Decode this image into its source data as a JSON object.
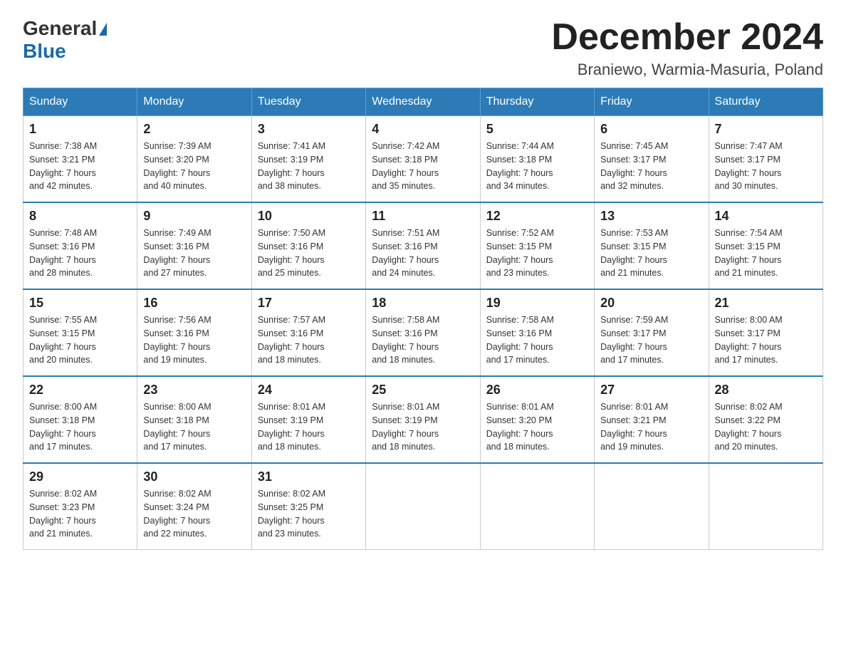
{
  "header": {
    "logo_general": "General",
    "logo_blue": "Blue",
    "month_title": "December 2024",
    "location": "Braniewo, Warmia-Masuria, Poland"
  },
  "weekdays": [
    "Sunday",
    "Monday",
    "Tuesday",
    "Wednesday",
    "Thursday",
    "Friday",
    "Saturday"
  ],
  "weeks": [
    [
      {
        "day": "1",
        "sunrise": "7:38 AM",
        "sunset": "3:21 PM",
        "daylight": "7 hours and 42 minutes."
      },
      {
        "day": "2",
        "sunrise": "7:39 AM",
        "sunset": "3:20 PM",
        "daylight": "7 hours and 40 minutes."
      },
      {
        "day": "3",
        "sunrise": "7:41 AM",
        "sunset": "3:19 PM",
        "daylight": "7 hours and 38 minutes."
      },
      {
        "day": "4",
        "sunrise": "7:42 AM",
        "sunset": "3:18 PM",
        "daylight": "7 hours and 35 minutes."
      },
      {
        "day": "5",
        "sunrise": "7:44 AM",
        "sunset": "3:18 PM",
        "daylight": "7 hours and 34 minutes."
      },
      {
        "day": "6",
        "sunrise": "7:45 AM",
        "sunset": "3:17 PM",
        "daylight": "7 hours and 32 minutes."
      },
      {
        "day": "7",
        "sunrise": "7:47 AM",
        "sunset": "3:17 PM",
        "daylight": "7 hours and 30 minutes."
      }
    ],
    [
      {
        "day": "8",
        "sunrise": "7:48 AM",
        "sunset": "3:16 PM",
        "daylight": "7 hours and 28 minutes."
      },
      {
        "day": "9",
        "sunrise": "7:49 AM",
        "sunset": "3:16 PM",
        "daylight": "7 hours and 27 minutes."
      },
      {
        "day": "10",
        "sunrise": "7:50 AM",
        "sunset": "3:16 PM",
        "daylight": "7 hours and 25 minutes."
      },
      {
        "day": "11",
        "sunrise": "7:51 AM",
        "sunset": "3:16 PM",
        "daylight": "7 hours and 24 minutes."
      },
      {
        "day": "12",
        "sunrise": "7:52 AM",
        "sunset": "3:15 PM",
        "daylight": "7 hours and 23 minutes."
      },
      {
        "day": "13",
        "sunrise": "7:53 AM",
        "sunset": "3:15 PM",
        "daylight": "7 hours and 21 minutes."
      },
      {
        "day": "14",
        "sunrise": "7:54 AM",
        "sunset": "3:15 PM",
        "daylight": "7 hours and 21 minutes."
      }
    ],
    [
      {
        "day": "15",
        "sunrise": "7:55 AM",
        "sunset": "3:15 PM",
        "daylight": "7 hours and 20 minutes."
      },
      {
        "day": "16",
        "sunrise": "7:56 AM",
        "sunset": "3:16 PM",
        "daylight": "7 hours and 19 minutes."
      },
      {
        "day": "17",
        "sunrise": "7:57 AM",
        "sunset": "3:16 PM",
        "daylight": "7 hours and 18 minutes."
      },
      {
        "day": "18",
        "sunrise": "7:58 AM",
        "sunset": "3:16 PM",
        "daylight": "7 hours and 18 minutes."
      },
      {
        "day": "19",
        "sunrise": "7:58 AM",
        "sunset": "3:16 PM",
        "daylight": "7 hours and 17 minutes."
      },
      {
        "day": "20",
        "sunrise": "7:59 AM",
        "sunset": "3:17 PM",
        "daylight": "7 hours and 17 minutes."
      },
      {
        "day": "21",
        "sunrise": "8:00 AM",
        "sunset": "3:17 PM",
        "daylight": "7 hours and 17 minutes."
      }
    ],
    [
      {
        "day": "22",
        "sunrise": "8:00 AM",
        "sunset": "3:18 PM",
        "daylight": "7 hours and 17 minutes."
      },
      {
        "day": "23",
        "sunrise": "8:00 AM",
        "sunset": "3:18 PM",
        "daylight": "7 hours and 17 minutes."
      },
      {
        "day": "24",
        "sunrise": "8:01 AM",
        "sunset": "3:19 PM",
        "daylight": "7 hours and 18 minutes."
      },
      {
        "day": "25",
        "sunrise": "8:01 AM",
        "sunset": "3:19 PM",
        "daylight": "7 hours and 18 minutes."
      },
      {
        "day": "26",
        "sunrise": "8:01 AM",
        "sunset": "3:20 PM",
        "daylight": "7 hours and 18 minutes."
      },
      {
        "day": "27",
        "sunrise": "8:01 AM",
        "sunset": "3:21 PM",
        "daylight": "7 hours and 19 minutes."
      },
      {
        "day": "28",
        "sunrise": "8:02 AM",
        "sunset": "3:22 PM",
        "daylight": "7 hours and 20 minutes."
      }
    ],
    [
      {
        "day": "29",
        "sunrise": "8:02 AM",
        "sunset": "3:23 PM",
        "daylight": "7 hours and 21 minutes."
      },
      {
        "day": "30",
        "sunrise": "8:02 AM",
        "sunset": "3:24 PM",
        "daylight": "7 hours and 22 minutes."
      },
      {
        "day": "31",
        "sunrise": "8:02 AM",
        "sunset": "3:25 PM",
        "daylight": "7 hours and 23 minutes."
      },
      null,
      null,
      null,
      null
    ]
  ],
  "labels": {
    "sunrise": "Sunrise:",
    "sunset": "Sunset:",
    "daylight": "Daylight:"
  }
}
